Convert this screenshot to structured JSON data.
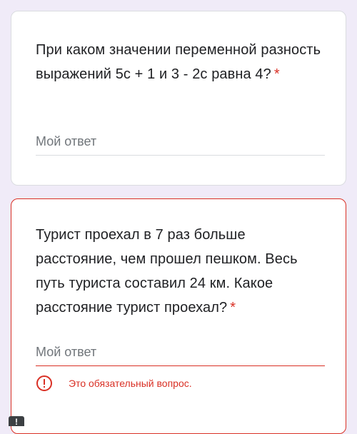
{
  "questions": [
    {
      "text": "При каком значении переменной разность выражений 5с + 1 и 3 - 2с равна 4?",
      "required_mark": "*",
      "answer_placeholder": "Мой ответ"
    },
    {
      "text": "Турист проехал в 7 раз больше расстояние, чем прошел пешком. Весь путь туриста составил 24 км. Какое расстояние турист проехал?",
      "required_mark": "*",
      "answer_placeholder": "Мой ответ",
      "error_text": "Это обязательный вопрос."
    }
  ],
  "colors": {
    "error": "#d93025",
    "background": "#f0ebf8",
    "card": "#ffffff"
  },
  "icons": {
    "error": "error-exclamation-icon",
    "bottom": "alert-icon"
  }
}
